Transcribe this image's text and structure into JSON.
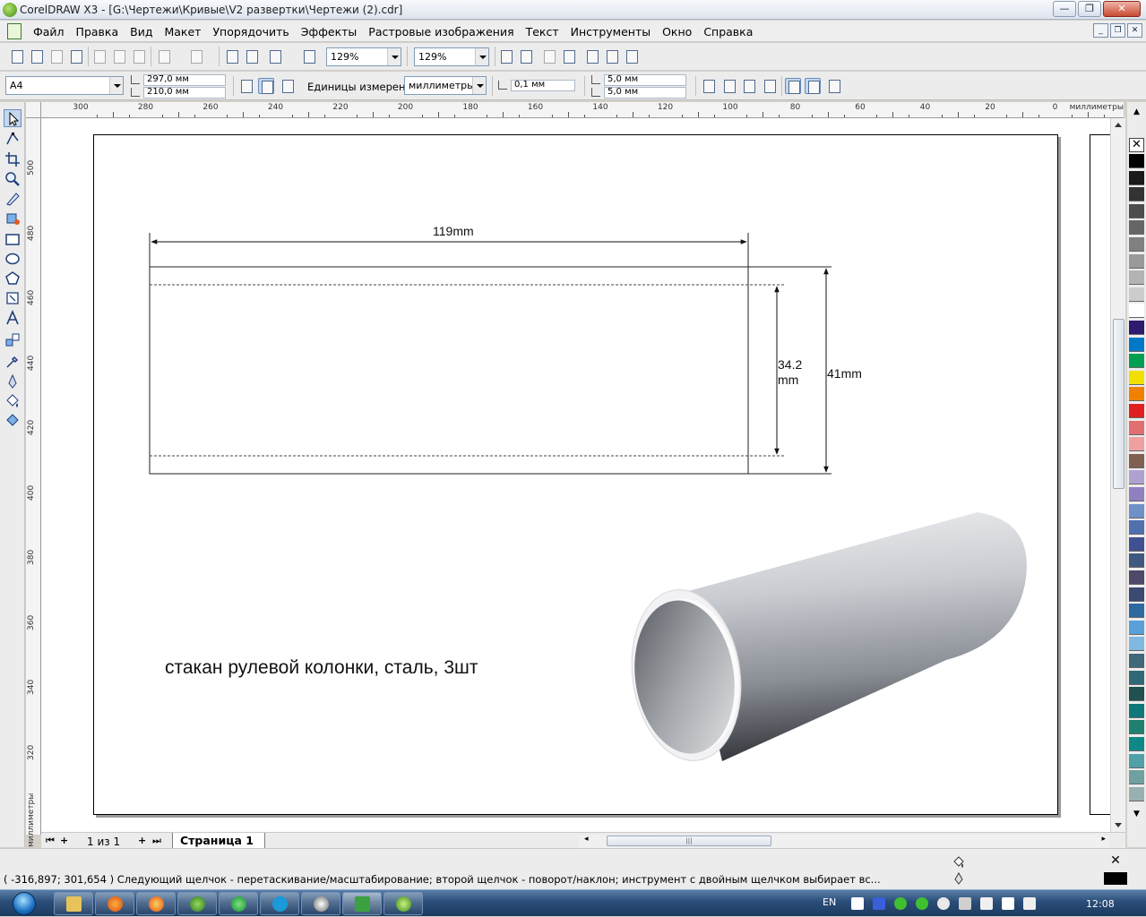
{
  "window": {
    "title": "CorelDRAW X3 - [G:\\Чертежи\\Кривые\\V2 развертки\\Чертежи (2).cdr]",
    "minimize": "—",
    "maximize": "❐",
    "close": "✕"
  },
  "menu": {
    "items": [
      "Файл",
      "Правка",
      "Вид",
      "Макет",
      "Упорядочить",
      "Эффекты",
      "Растровые изображения",
      "Текст",
      "Инструменты",
      "Окно",
      "Справка"
    ]
  },
  "toolbar": {
    "zoom_level_1": "129%",
    "zoom_level_2": "129%"
  },
  "property_bar": {
    "paper_size": "A4",
    "page_width": "297,0 мм",
    "page_height": "210,0 мм",
    "units_label": "Единицы измерения:",
    "units_value": "миллиметры",
    "nudge": "0,1 мм",
    "dup_x": "5,0 мм",
    "dup_y": "5,0 мм"
  },
  "ruler": {
    "top_labels": [
      "300",
      "280",
      "260",
      "240",
      "220",
      "200",
      "180",
      "160",
      "140",
      "120",
      "100",
      "80",
      "60",
      "40",
      "20",
      "0"
    ],
    "top_unit": "миллиметры",
    "left_labels": [
      "500",
      "480",
      "460",
      "440",
      "420",
      "400",
      "380",
      "360",
      "340",
      "320"
    ],
    "left_unit": "миллиметры"
  },
  "drawing": {
    "dim_length": "119mm",
    "dim_inner_line1": "34.2",
    "dim_inner_line2": "mm",
    "dim_outer": "41mm",
    "caption": "стакан рулевой колонки, сталь, 3шт"
  },
  "page_nav": {
    "count": "1 из 1",
    "tab": "Страница 1"
  },
  "status": {
    "text": "( -316,897; 301,654 )   Следующий щелчок - перетаскивание/масштабирование; второй щелчок - поворот/наклон; инструмент с двойным щелчком выбирает вс..."
  },
  "palette": {
    "colors": [
      "#ffffff",
      "#000000",
      "#1a1a1a",
      "#333333",
      "#4d4d4d",
      "#666666",
      "#808080",
      "#999999",
      "#b3b3b3",
      "#cccccc",
      "#ffffff",
      "#2e1a6e",
      "#0078c8",
      "#00a050",
      "#f0e000",
      "#f08000",
      "#e02020",
      "#e07070",
      "#f0a0a0",
      "#806050",
      "#b0a0d0",
      "#9080c0",
      "#7090c8",
      "#5070b0",
      "#405090",
      "#405880",
      "#504868",
      "#3a4a70",
      "#2e6aa0",
      "#5aa0d8",
      "#80b8e0",
      "#406878",
      "#306878",
      "#205050",
      "#107878",
      "#208070",
      "#108888",
      "#50a0a8",
      "#70a0a0",
      "#98b0b0"
    ]
  },
  "taskbar": {
    "lang": "EN",
    "time": "12:08"
  }
}
